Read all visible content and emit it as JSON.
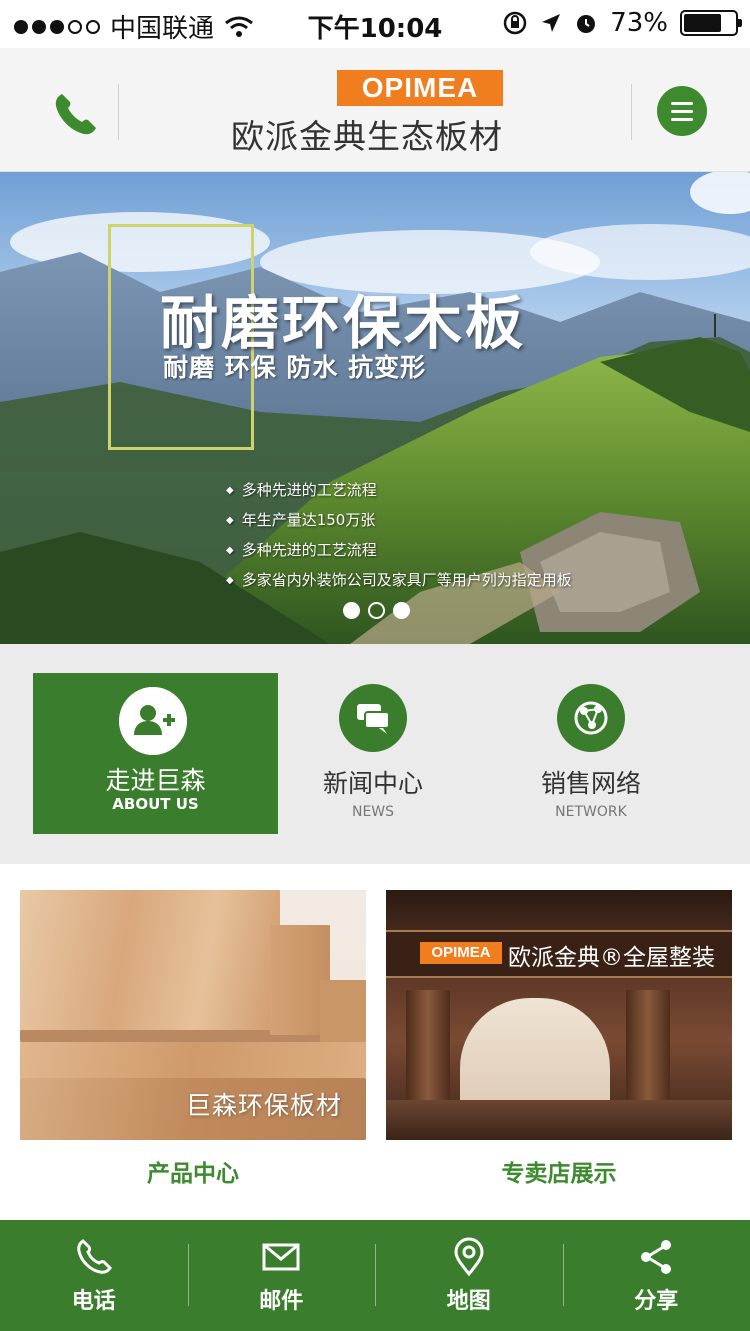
{
  "status_bar": {
    "carrier": "中国联通",
    "time": "下午10:04",
    "battery": "73%",
    "battery_level": 0.73
  },
  "header": {
    "logo_text": "OPIMEA",
    "brand_name": "欧派金典生态板材",
    "icons": {
      "left": "phone-icon",
      "right": "menu-icon"
    }
  },
  "banner": {
    "title": "耐磨环保木板",
    "subtitle": "耐磨 环保 防水 抗变形",
    "bullets": [
      "多种先进的工艺流程",
      "年生产量达150万张",
      "多种先进的工艺流程",
      "多家省内外装饰公司及家具厂等用户列为指定用板"
    ],
    "pager": {
      "total": 3,
      "active": 1
    }
  },
  "features": [
    {
      "title": "走进巨森",
      "subtitle": "ABOUT US",
      "icon": "add-user-icon",
      "active": true
    },
    {
      "title": "新闻中心",
      "subtitle": "NEWS",
      "icon": "chat-icon"
    },
    {
      "title": "销售网络",
      "subtitle": "NETWORK",
      "icon": "network-icon"
    }
  ],
  "products": [
    {
      "caption": "产品中心",
      "image_text": "巨森环保板材"
    },
    {
      "caption": "专卖店展示",
      "store_logo": "OPIMEA",
      "store_sign": "欧派金典®全屋整装"
    }
  ],
  "bottom_nav": [
    {
      "label": "电话",
      "icon": "phone-icon"
    },
    {
      "label": "邮件",
      "icon": "mail-icon"
    },
    {
      "label": "地图",
      "icon": "map-pin-icon"
    },
    {
      "label": "分享",
      "icon": "share-icon"
    }
  ],
  "colors": {
    "brand_green": "#3a7d2c",
    "logo_orange": "#f07d1e"
  }
}
